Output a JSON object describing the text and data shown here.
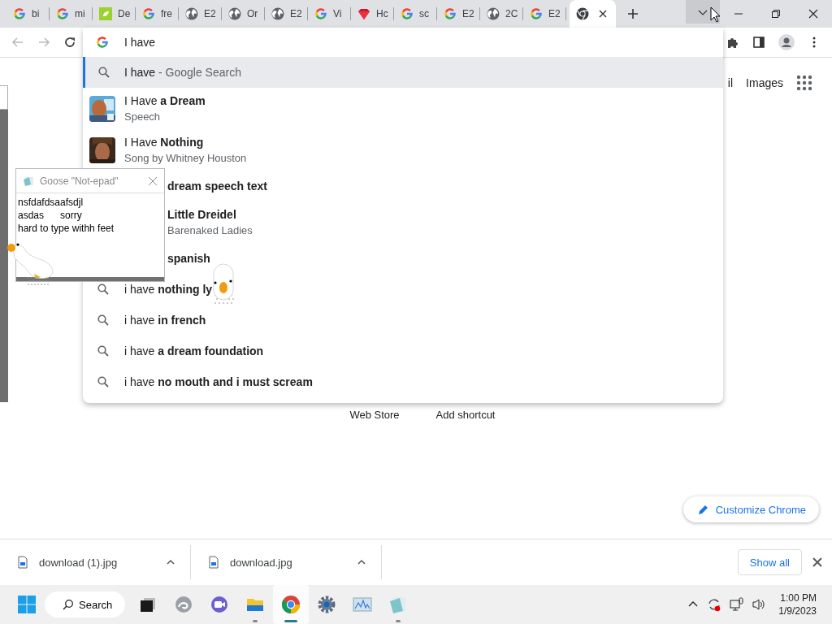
{
  "tabs": [
    {
      "kind": "google",
      "label": "bi",
      "selected": false
    },
    {
      "kind": "google",
      "label": "mi",
      "selected": false
    },
    {
      "kind": "leaf",
      "label": "De",
      "selected": false
    },
    {
      "kind": "google",
      "label": "fre",
      "selected": false
    },
    {
      "kind": "globe",
      "label": "E2",
      "selected": false
    },
    {
      "kind": "globe",
      "label": "Or",
      "selected": false
    },
    {
      "kind": "globe",
      "label": "E2",
      "selected": false
    },
    {
      "kind": "google",
      "label": "Vi",
      "selected": false
    },
    {
      "kind": "gem",
      "label": "Hc",
      "selected": false
    },
    {
      "kind": "google",
      "label": "sc",
      "selected": false
    },
    {
      "kind": "google",
      "label": "E2",
      "selected": false
    },
    {
      "kind": "globe",
      "label": "2C",
      "selected": false
    },
    {
      "kind": "google",
      "label": "E2",
      "selected": false
    },
    {
      "kind": "chrome",
      "selected": true
    }
  ],
  "omnibox": {
    "value": "I have",
    "suggestions": [
      {
        "kind": "search",
        "text": "I have",
        "suffix": "- Google Search",
        "selected": true
      },
      {
        "kind": "entity",
        "text": "I Have **a Dream**",
        "subtitle": "Speech",
        "selected": false
      },
      {
        "kind": "entity",
        "text": "I Have **Nothing**",
        "subtitle": "Song by Whitney Houston",
        "selected": false
      },
      {
        "kind": "partial",
        "text": "**dream speech text**",
        "selected": false
      },
      {
        "kind": "partial",
        "text": "**Little Dreidel**",
        "subtitle": "Barenaked Ladies",
        "selected": false
      },
      {
        "kind": "partial",
        "text": "**spanish**",
        "selected": false
      },
      {
        "kind": "search",
        "text": "i have **nothing ly**",
        "selected": false
      },
      {
        "kind": "search",
        "text": "i have **in french**",
        "selected": false
      },
      {
        "kind": "search",
        "text": "i have **a dream foundation**",
        "selected": false
      },
      {
        "kind": "search",
        "text": "i have **no mouth and i must scream**",
        "selected": false
      }
    ]
  },
  "page": {
    "links": [
      "il",
      "Images"
    ],
    "shortcuts": [
      "Web Store",
      "Add shortcut"
    ],
    "customize": "Customize Chrome"
  },
  "notepad": {
    "title": "Goose \"Not-epad\"",
    "lines": [
      "nsfdafdsaafsdjl",
      "asdas      sorry",
      "hard to type withh feet"
    ]
  },
  "downloads": {
    "items": [
      {
        "name": "download (1).jpg"
      },
      {
        "name": "download.jpg"
      }
    ],
    "show_all": "Show all"
  },
  "taskbar": {
    "search": "Search",
    "apps": [
      {
        "kind": "task-view",
        "open": false,
        "selected": false
      },
      {
        "kind": "edge",
        "open": false,
        "selected": false
      },
      {
        "kind": "teams",
        "open": false,
        "selected": false
      },
      {
        "kind": "explorer",
        "open": true,
        "selected": false
      },
      {
        "kind": "chrome",
        "open": true,
        "selected": true
      },
      {
        "kind": "settings",
        "open": false,
        "selected": false
      },
      {
        "kind": "monitor",
        "open": false,
        "selected": false
      },
      {
        "kind": "notepad",
        "open": true,
        "selected": false
      }
    ],
    "time": "1:00 PM",
    "date": "1/9/2023"
  }
}
